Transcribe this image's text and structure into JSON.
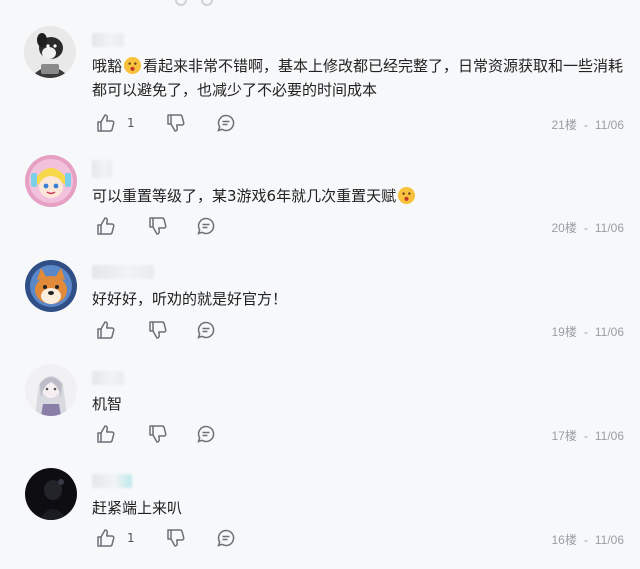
{
  "comments": [
    {
      "avatar": "dog-cartoon-avatar",
      "body_line1_before": "哦豁",
      "body_line1_after": "看起来非常不错啊，基本上修改都已经完整了，日常资源获取和一些消耗",
      "body_line2": "都可以避免了，也减少了不必要的时间成本",
      "like_count": "1",
      "floor": "21楼",
      "date": "11/06"
    },
    {
      "avatar": "anime-girl-avatar",
      "body": "可以重置等级了，某3游戏6年就几次重置天赋",
      "like_count": "",
      "floor": "20楼",
      "date": "11/06"
    },
    {
      "avatar": "shiba-dog-avatar",
      "body": "好好好，听劝的就是好官方！",
      "like_count": "",
      "floor": "19楼",
      "date": "11/06"
    },
    {
      "avatar": "white-hair-character-avatar",
      "body": "机智",
      "like_count": "",
      "floor": "17楼",
      "date": "11/06"
    },
    {
      "avatar": "dark-figure-avatar",
      "body": "赶紧端上来叭",
      "like_count": "1",
      "floor": "16楼",
      "date": "11/06"
    }
  ],
  "icons": {
    "like": "thumbs-up-icon",
    "dislike": "thumbs-down-icon",
    "reply": "reply-bubble-icon",
    "emoji": "smile-emoji-icon"
  },
  "colors": {
    "background": "#f7f8fa",
    "text": "#222222",
    "meta": "#9a9ea5",
    "icon": "#6b6f76"
  }
}
